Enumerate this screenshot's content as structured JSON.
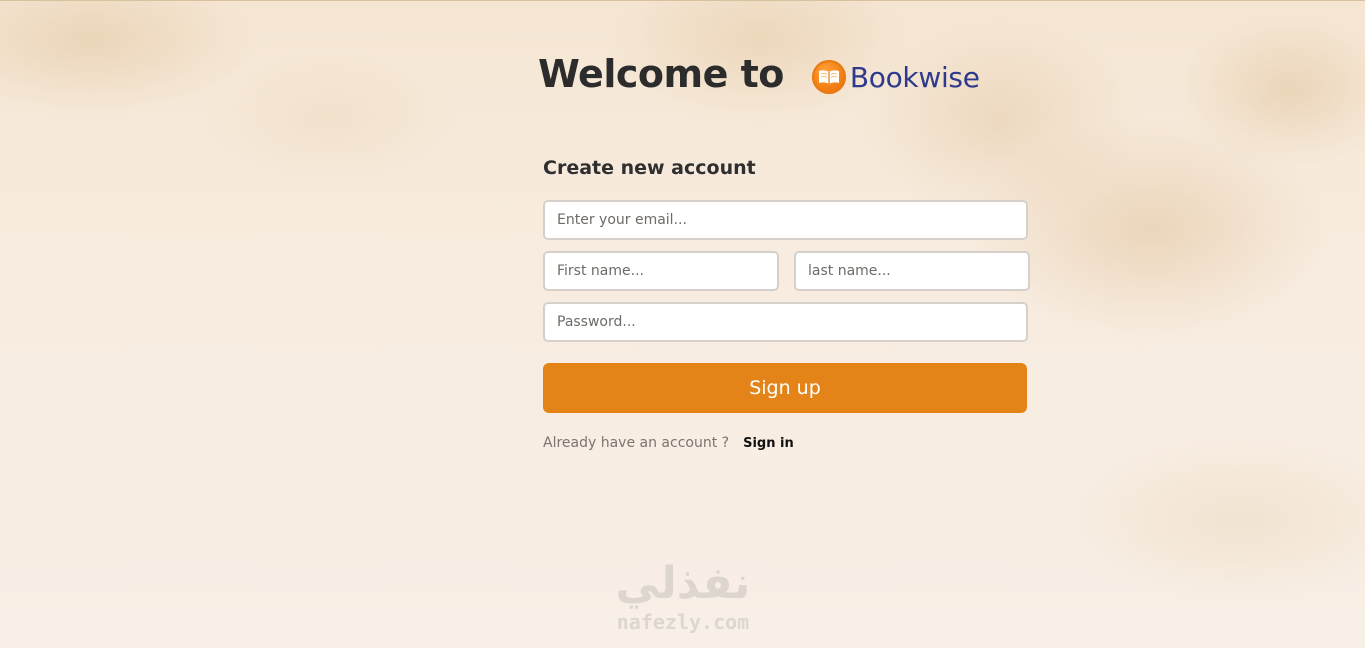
{
  "header": {
    "welcome_text": "Welcome to",
    "brand_name": "Bookwise",
    "brand_color": "#2e3a8c",
    "logo_icon": "open-book-icon"
  },
  "form": {
    "title": "Create new account",
    "email": {
      "placeholder": "Enter your email...",
      "value": ""
    },
    "first_name": {
      "placeholder": "First name...",
      "value": ""
    },
    "last_name": {
      "placeholder": "last name...",
      "value": ""
    },
    "password": {
      "placeholder": "Password...",
      "value": ""
    },
    "submit_label": "Sign up",
    "accent_color": "#e48418",
    "already_text": "Already have an account ?",
    "signin_label": "Sign in"
  },
  "watermark": {
    "arabic": "نفذلي",
    "latin": "nafezly.com"
  }
}
